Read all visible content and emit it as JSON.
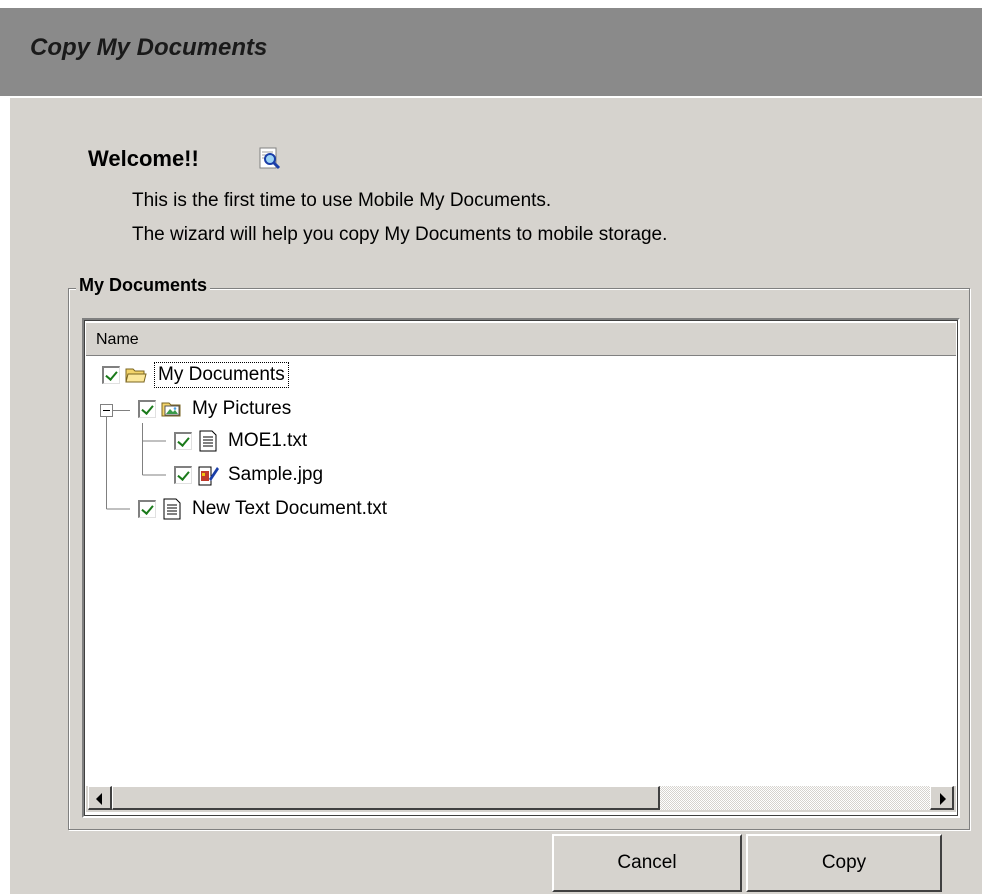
{
  "window": {
    "title": "Copy My Documents"
  },
  "welcome": {
    "heading": "Welcome!!",
    "icon": "magnifier-icon",
    "line1": "This is the first time to use Mobile My Documents.",
    "line2": "The wizard will help you copy My Documents to mobile storage."
  },
  "group": {
    "label": "My Documents"
  },
  "tree": {
    "column_header": "Name",
    "items": [
      {
        "label": "My Documents",
        "icon": "open-folder-icon",
        "checked": true
      },
      {
        "label": "My Pictures",
        "icon": "pictures-folder-icon",
        "checked": true
      },
      {
        "label": "MOE1.txt",
        "icon": "text-file-icon",
        "checked": true
      },
      {
        "label": "Sample.jpg",
        "icon": "image-file-icon",
        "checked": true
      },
      {
        "label": "New Text Document.txt",
        "icon": "text-file-icon",
        "checked": true
      }
    ]
  },
  "buttons": {
    "cancel": "Cancel",
    "copy": "Copy"
  },
  "colors": {
    "titlebar": "#8a8a8a",
    "dialog_bg": "#d6d3ce",
    "check": "#1a7a1a"
  }
}
